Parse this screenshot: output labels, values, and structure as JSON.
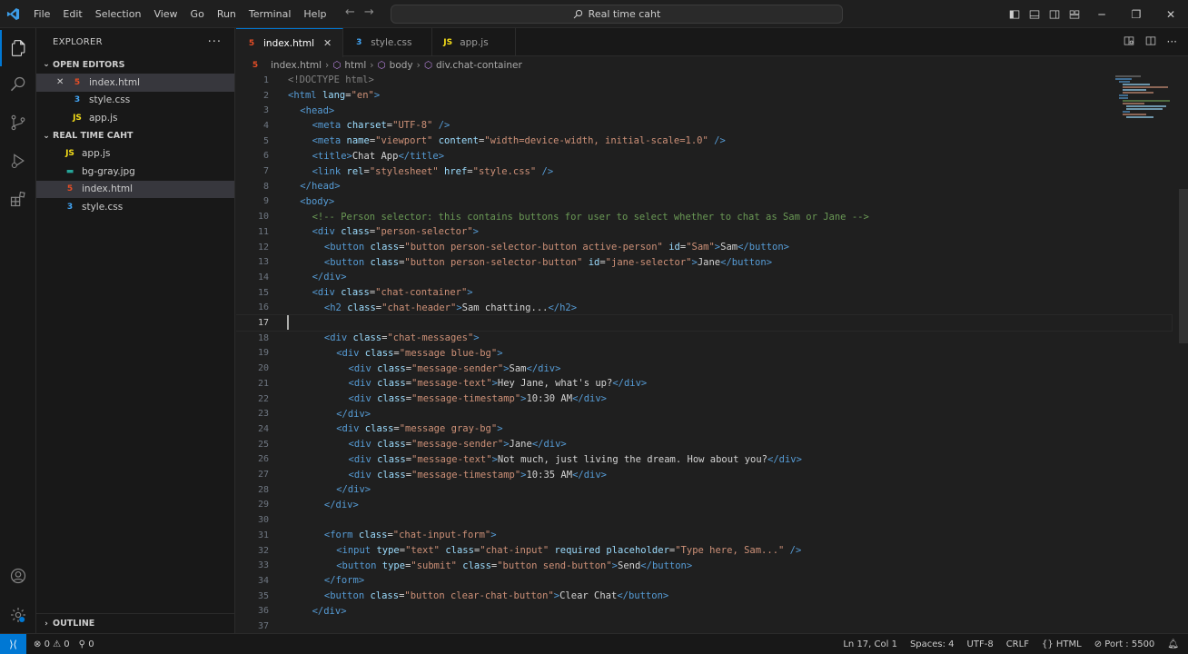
{
  "menu": [
    "File",
    "Edit",
    "Selection",
    "View",
    "Go",
    "Run",
    "Terminal",
    "Help"
  ],
  "search": {
    "label": "Real time caht"
  },
  "sidebar": {
    "title": "EXPLORER",
    "open_editors_label": "OPEN EDITORS",
    "open_editors": [
      "index.html",
      "style.css",
      "app.js"
    ],
    "folder_label": "REAL TIME CAHT",
    "files": [
      "app.js",
      "bg-gray.jpg",
      "index.html",
      "style.css"
    ],
    "outline_label": "OUTLINE"
  },
  "tabs": [
    "index.html",
    "style.css",
    "app.js"
  ],
  "breadcrumb": [
    "index.html",
    "html",
    "body",
    "div.chat-container"
  ],
  "editor": {
    "current_line": 17,
    "lines": [
      "1",
      "2",
      "3",
      "4",
      "5",
      "6",
      "7",
      "8",
      "9",
      "10",
      "11",
      "12",
      "13",
      "14",
      "15",
      "16",
      "17",
      "18",
      "19",
      "20",
      "21",
      "22",
      "23",
      "24",
      "25",
      "26",
      "27",
      "28",
      "29",
      "30",
      "31",
      "32",
      "33",
      "34",
      "35",
      "36",
      "37"
    ]
  },
  "status": {
    "errors": "0",
    "warnings": "0",
    "ports": "0",
    "position": "Ln 17, Col 1",
    "spaces": "Spaces: 4",
    "encoding": "UTF-8",
    "eol": "CRLF",
    "language": "HTML",
    "port": "Port : 5500"
  },
  "colors": {
    "accent": "#0078d4",
    "tag": "#569cd6",
    "attr": "#9cdcfe",
    "string": "#ce9178",
    "comment": "#6a9955"
  }
}
